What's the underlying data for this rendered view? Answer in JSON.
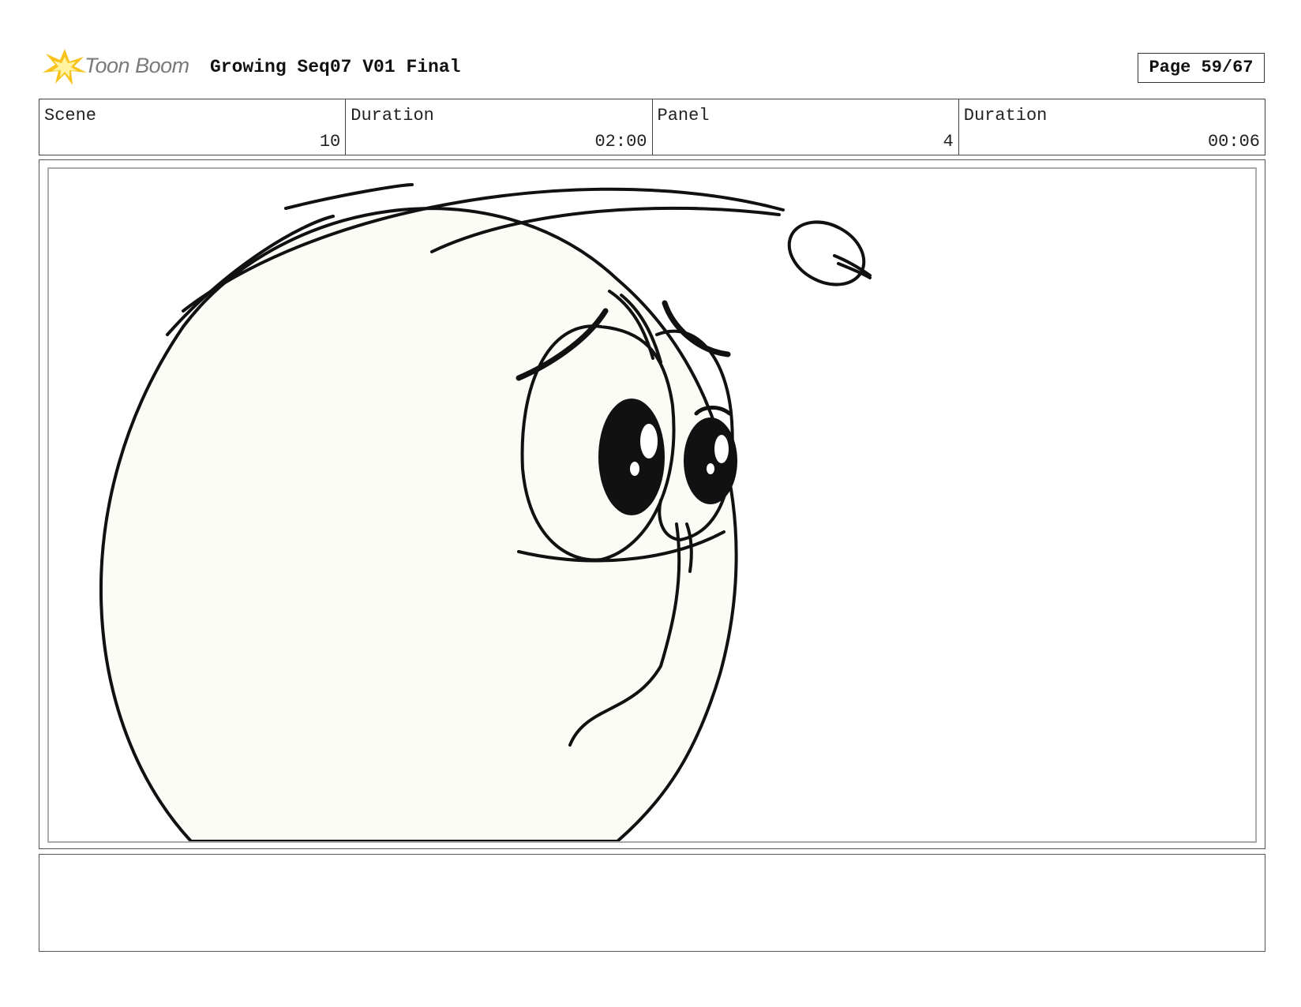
{
  "header": {
    "logo_text": "Toon Boom",
    "title": "Growing Seq07 V01 Final",
    "page": "Page 59/67"
  },
  "info": [
    {
      "label": "Scene",
      "value": "10"
    },
    {
      "label": "Duration",
      "value": "02:00"
    },
    {
      "label": "Panel",
      "value": "4"
    },
    {
      "label": "Duration",
      "value": "00:06"
    }
  ],
  "panel": {
    "character_fill": "#fbfcf6",
    "line_color": "#111111"
  },
  "notes": {
    "text": ""
  }
}
